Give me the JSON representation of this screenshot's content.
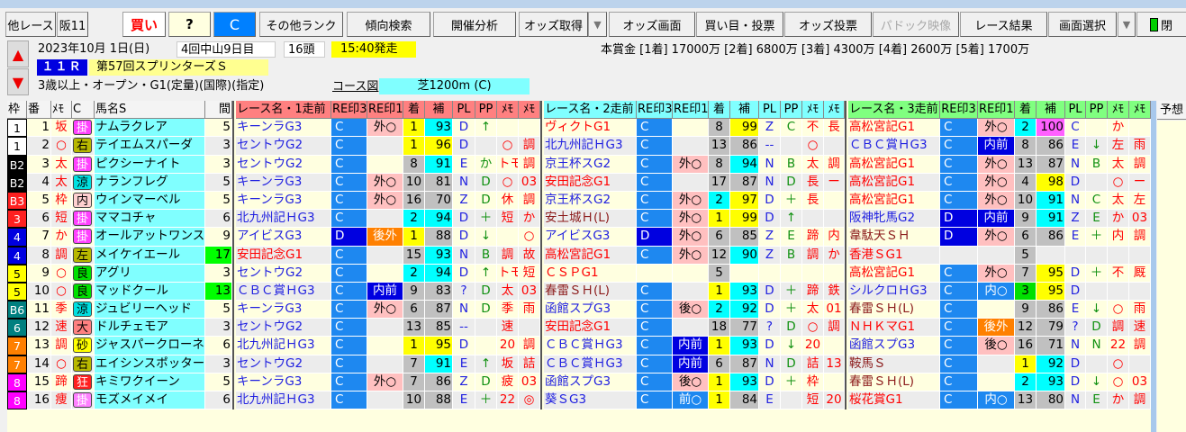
{
  "toolbar": {
    "other_race": "他レース",
    "venue": "阪11",
    "buy": "買い",
    "question": "?",
    "rank": "C",
    "other_rank": "その他ランク",
    "trend": "傾向検索",
    "meet": "開催分析",
    "odds_get": "オッズ取得",
    "dropdown": "▼",
    "odds_screen": "オッズ画面",
    "bet": "買い目・投票",
    "odds_bet": "オッズ投票",
    "paddock": "パドック映像",
    "result": "レース結果",
    "screen_select": "画面選択",
    "dropdown2": "▼",
    "close": "閉"
  },
  "race": {
    "date": "2023年10月 1日(日)",
    "meeting": "4回中山9日目",
    "runners": "16頭",
    "start": "15:40発走",
    "number": "１１Ｒ",
    "name": "第57回スプリンターズＳ",
    "conditions": "3歳以上・オープン・G1(定量)(国際)(指定)",
    "course_link": "コース図",
    "course": "芝1200m (C)",
    "prize": "本賞金 [1着] 17000万 [2着] 6800万 [3着] 4300万 [4着] 2600万 [5着] 1700万"
  },
  "colors": {
    "waku": {
      "1": "#ffffff",
      "2": "#000000",
      "3": "#ff2020",
      "4": "#0000e0",
      "5": "#ffff00",
      "6": "#008080",
      "7": "#ff8000",
      "8": "#ff00ff"
    }
  },
  "headers": {
    "left": [
      "枠",
      "番",
      "ﾒﾓ",
      "C",
      "馬名S",
      "間"
    ],
    "run1": [
      "レース名・1走前",
      "RE印3",
      "RE印1",
      "着",
      "補",
      "PL",
      "PP",
      "ﾒﾓ",
      "ﾒﾓ"
    ],
    "run2": [
      "レース名・2走前",
      "RE印3",
      "RE印1",
      "着",
      "補",
      "PL",
      "PP",
      "ﾒﾓ",
      "ﾒﾓ"
    ],
    "run3": [
      "レース名・3走前",
      "RE印3",
      "RE印1",
      "着",
      "補",
      "PL",
      "PP",
      "ﾒﾓ",
      "ﾒﾓ"
    ],
    "yoso": "予想"
  },
  "rows": [
    {
      "waku": "1",
      "wk": 1,
      "num": "1",
      "memo": "坂",
      "c": "掛",
      "cc": "#ff40ff",
      "name": "ナムラクレア",
      "gap": "5",
      "runs": [
        [
          "キーンラG3",
          "C",
          "外○",
          "1",
          "93",
          "D",
          "↑",
          "",
          ""
        ],
        [
          "ヴィクトG1",
          "C",
          "",
          "8",
          "99",
          "Z",
          "C",
          "不",
          "長"
        ],
        [
          "高松宮記G1",
          "C",
          "外○",
          "2",
          "100",
          "C",
          "",
          "か",
          ""
        ]
      ]
    },
    {
      "waku": "1",
      "wk": 1,
      "num": "2",
      "memo": "○",
      "c": "右",
      "cc": "#b8b800",
      "name": "テイエムスパーダ",
      "gap": "3",
      "runs": [
        [
          "セントウG2",
          "C",
          "",
          "1",
          "96",
          "D",
          "",
          "○",
          "調"
        ],
        [
          "北九州記ＨG3",
          "C",
          "",
          "13",
          "86",
          "--",
          "",
          "○",
          ""
        ],
        [
          "ＣＢＣ賞ＨG3",
          "C",
          "内前",
          "8",
          "86",
          "E",
          "↓",
          "左",
          "雨"
        ]
      ]
    },
    {
      "waku": "B2",
      "wk": 2,
      "num": "3",
      "memo": "太",
      "c": "掛",
      "cc": "#ff40ff",
      "name": "ピクシーナイト",
      "gap": "3",
      "runs": [
        [
          "セントウG2",
          "C",
          "",
          "8",
          "91",
          "E",
          "か",
          "トモ",
          "調"
        ],
        [
          "京王杯スG2",
          "C",
          "外○",
          "8",
          "94",
          "N",
          "B",
          "太",
          "調"
        ],
        [
          "高松宮記G1",
          "C",
          "外○",
          "13",
          "87",
          "N",
          "B",
          "太",
          "調"
        ]
      ]
    },
    {
      "waku": "B2",
      "wk": 2,
      "num": "4",
      "memo": "太",
      "c": "涼",
      "cc": "#00e0e0",
      "name": "ナランフレグ",
      "gap": "5",
      "runs": [
        [
          "キーンラG3",
          "C",
          "外○",
          "10",
          "81",
          "N",
          "D",
          "○",
          "03"
        ],
        [
          "安田記念G1",
          "C",
          "",
          "17",
          "87",
          "N",
          "D",
          "長",
          "ー"
        ],
        [
          "高松宮記G1",
          "C",
          "外○",
          "4",
          "98",
          "D",
          "",
          "○",
          "ー"
        ]
      ]
    },
    {
      "waku": "B3",
      "wk": 3,
      "num": "5",
      "memo": "枠",
      "c": "内",
      "cc": "#ffd0d0",
      "name": "ウインマーベル",
      "gap": "5",
      "runs": [
        [
          "キーンラG3",
          "C",
          "外○",
          "16",
          "70",
          "Z",
          "D",
          "休",
          "調"
        ],
        [
          "京王杯スG2",
          "C",
          "外○",
          "2",
          "97",
          "D",
          "＋",
          "長",
          ""
        ],
        [
          "高松宮記G1",
          "C",
          "外○",
          "10",
          "91",
          "N",
          "C",
          "太",
          "左"
        ]
      ]
    },
    {
      "waku": "3",
      "wk": 3,
      "num": "6",
      "memo": "短",
      "c": "掛",
      "cc": "#ff40ff",
      "name": "ママコチャ",
      "gap": "6",
      "runs": [
        [
          "北九州記ＨG3",
          "C",
          "",
          "2",
          "94",
          "D",
          "＋",
          "短",
          "か"
        ],
        [
          "安土城Ｈ(L)",
          "C",
          "外○",
          "1",
          "99",
          "D",
          "↑",
          "",
          ""
        ],
        [
          "阪神牝馬G2",
          "D",
          "内前",
          "9",
          "91",
          "Z",
          "E",
          "か",
          "03"
        ]
      ]
    },
    {
      "waku": "4",
      "wk": 4,
      "num": "7",
      "memo": "か",
      "c": "掛",
      "cc": "#ff40ff",
      "name": "オールアットワンス",
      "gap": "9",
      "runs": [
        [
          "アイビスG3",
          "D",
          "後外",
          "1",
          "88",
          "D",
          "↓",
          "",
          "○"
        ],
        [
          "アイビスG3",
          "D",
          "外○",
          "6",
          "85",
          "Z",
          "E",
          "蹄",
          "内"
        ],
        [
          "韋駄天ＳＨ",
          "D",
          "外○",
          "6",
          "86",
          "E",
          "＋",
          "内",
          "調"
        ]
      ]
    },
    {
      "waku": "4",
      "wk": 4,
      "num": "8",
      "memo": "調",
      "c": "左",
      "cc": "#b8b800",
      "name": "メイケイエール",
      "gap": "17",
      "gapHi": true,
      "runs": [
        [
          "安田記念G1",
          "C",
          "",
          "15",
          "93",
          "N",
          "B",
          "調",
          "故"
        ],
        [
          "高松宮記G1",
          "C",
          "外○",
          "12",
          "90",
          "Z",
          "B",
          "調",
          "か"
        ],
        [
          "香港ＳG1",
          "",
          "",
          "5",
          "",
          "",
          "",
          "",
          ""
        ]
      ]
    },
    {
      "waku": "5",
      "wk": 5,
      "num": "9",
      "memo": "○",
      "c": "良",
      "cc": "#00e000",
      "name": "アグリ",
      "gap": "3",
      "runs": [
        [
          "セントウG2",
          "C",
          "",
          "2",
          "94",
          "D",
          "↑",
          "トモ",
          "短"
        ],
        [
          "ＣＳＰG1",
          "",
          "",
          "5",
          "",
          "",
          "",
          "",
          ""
        ],
        [
          "高松宮記G1",
          "C",
          "外○",
          "7",
          "95",
          "D",
          "＋",
          "不",
          "厩"
        ]
      ]
    },
    {
      "waku": "5",
      "wk": 5,
      "num": "10",
      "memo": "○",
      "c": "良",
      "cc": "#00e000",
      "name": "マッドクール",
      "gap": "13",
      "gapHi": true,
      "runs": [
        [
          "ＣＢＣ賞ＨG3",
          "C",
          "内前",
          "9",
          "83",
          "?",
          "D",
          "太",
          "03"
        ],
        [
          "春雷ＳＨ(L)",
          "C",
          "",
          "1",
          "93",
          "D",
          "＋",
          "蹄",
          "鉄"
        ],
        [
          "シルクロＨG3",
          "C",
          "内○",
          "3",
          "95",
          "D",
          "",
          "",
          ""
        ]
      ]
    },
    {
      "waku": "B6",
      "wk": 6,
      "num": "11",
      "memo": "季",
      "c": "涼",
      "cc": "#00e0e0",
      "name": "ジュビリーヘッド",
      "gap": "5",
      "runs": [
        [
          "キーンラG3",
          "C",
          "外○",
          "6",
          "87",
          "N",
          "D",
          "季",
          "雨"
        ],
        [
          "函館スプG3",
          "C",
          "後○",
          "2",
          "92",
          "D",
          "＋",
          "太",
          "01"
        ],
        [
          "春雷ＳＨ(L)",
          "C",
          "",
          "9",
          "86",
          "E",
          "↓",
          "○",
          "雨"
        ]
      ]
    },
    {
      "waku": "6",
      "wk": 6,
      "num": "12",
      "memo": "速",
      "c": "大",
      "cc": "#ff8080",
      "name": "ドルチェモア",
      "gap": "3",
      "runs": [
        [
          "セントウG2",
          "C",
          "",
          "13",
          "85",
          "--",
          "",
          "速",
          ""
        ],
        [
          "安田記念G1",
          "C",
          "",
          "18",
          "77",
          "?",
          "D",
          "○",
          "調"
        ],
        [
          "ＮＨＫマG1",
          "C",
          "後外",
          "12",
          "79",
          "?",
          "D",
          "調",
          "速"
        ]
      ]
    },
    {
      "waku": "7",
      "wk": 7,
      "num": "13",
      "memo": "調",
      "c": "砂",
      "cc": "#ffff00",
      "name": "ジャスパークローネ",
      "gap": "6",
      "runs": [
        [
          "北九州記ＨG3",
          "C",
          "",
          "1",
          "95",
          "D",
          "",
          "20",
          "調"
        ],
        [
          "ＣＢＣ賞ＨG3",
          "C",
          "内前",
          "1",
          "93",
          "D",
          "↓",
          "20",
          ""
        ],
        [
          "函館スプG3",
          "C",
          "後○",
          "16",
          "71",
          "N",
          "N",
          "22",
          "調"
        ]
      ]
    },
    {
      "waku": "7",
      "wk": 7,
      "num": "14",
      "memo": "○",
      "c": "右",
      "cc": "#b8b800",
      "name": "エイシンスポッター",
      "gap": "3",
      "runs": [
        [
          "セントウG2",
          "C",
          "",
          "7",
          "91",
          "E",
          "↑",
          "坂",
          "詰"
        ],
        [
          "ＣＢＣ賞ＨG3",
          "C",
          "内前",
          "6",
          "87",
          "N",
          "D",
          "詰",
          "13"
        ],
        [
          "鞍馬Ｓ",
          "C",
          "",
          "1",
          "92",
          "D",
          "",
          "○",
          ""
        ]
      ]
    },
    {
      "waku": "8",
      "wk": 8,
      "num": "15",
      "memo": "蹄",
      "c": "狂",
      "cc": "#ff2020",
      "name": "キミワクイーン",
      "gap": "5",
      "runs": [
        [
          "キーンラG3",
          "C",
          "外○",
          "7",
          "86",
          "Z",
          "D",
          "疲",
          "03"
        ],
        [
          "函館スプG3",
          "C",
          "後○",
          "1",
          "93",
          "D",
          "＋",
          "枠",
          ""
        ],
        [
          "春雷ＳＨ(L)",
          "C",
          "",
          "2",
          "93",
          "D",
          "↓",
          "○",
          "03"
        ]
      ]
    },
    {
      "waku": "8",
      "wk": 8,
      "num": "16",
      "memo": "痩",
      "c": "掛",
      "cc": "#ff80ff",
      "name": "モズメイメイ",
      "gap": "6",
      "runs": [
        [
          "北九州記ＨG3",
          "C",
          "",
          "10",
          "88",
          "E",
          "＋",
          "22",
          "◎"
        ],
        [
          "葵ＳG3",
          "C",
          "前○",
          "1",
          "84",
          "E",
          "",
          "短",
          "20"
        ],
        [
          "桜花賞G1",
          "C",
          "内○",
          "13",
          "80",
          "N",
          "E",
          "か",
          "調"
        ]
      ]
    }
  ]
}
